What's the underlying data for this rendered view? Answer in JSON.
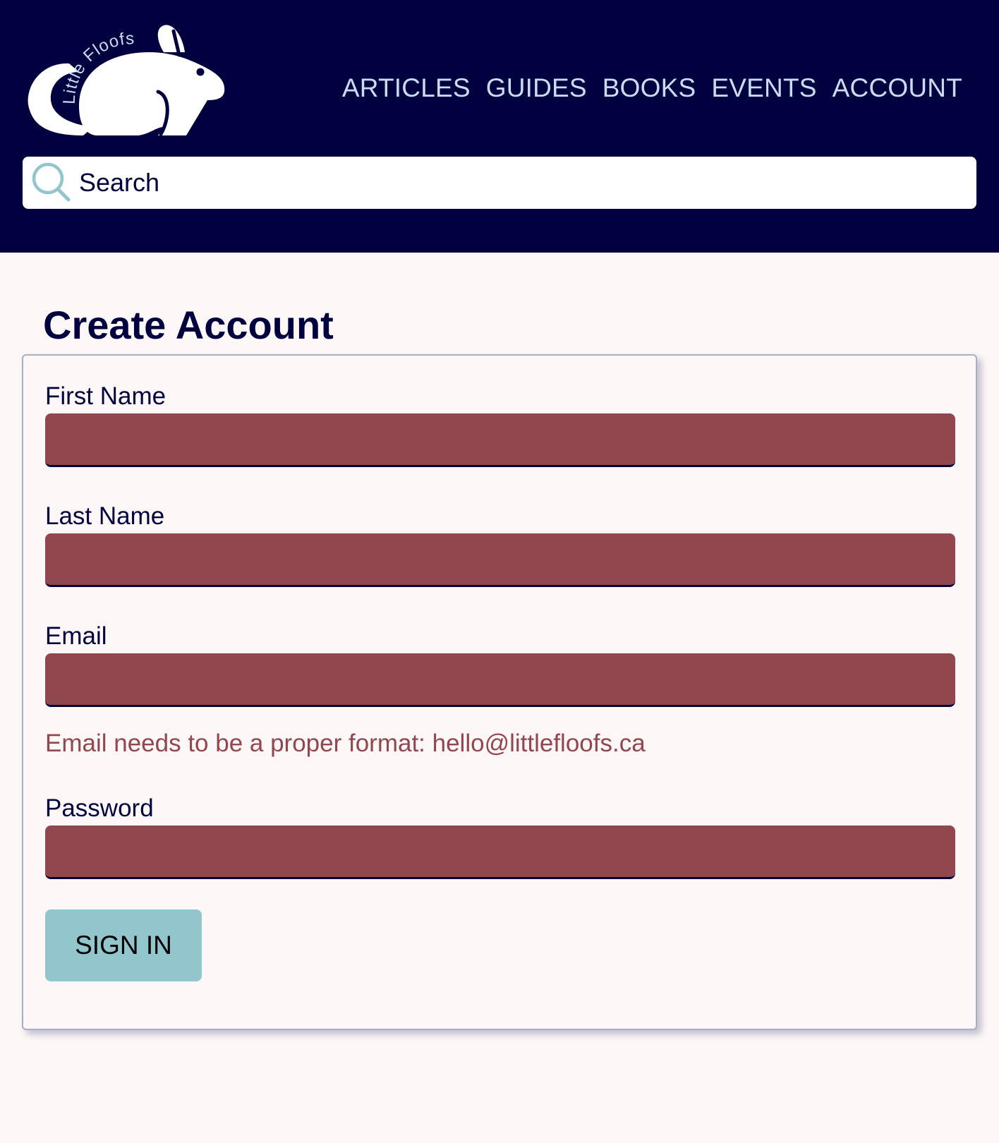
{
  "header": {
    "logo": {
      "text": "Little Floofs"
    },
    "nav": [
      {
        "label": "ARTICLES"
      },
      {
        "label": "GUIDES"
      },
      {
        "label": "BOOKS"
      },
      {
        "label": "EVENTS"
      },
      {
        "label": "ACCOUNT"
      }
    ],
    "search": {
      "placeholder": "Search",
      "value": ""
    }
  },
  "page": {
    "title": "Create Account"
  },
  "form": {
    "first_name": {
      "label": "First Name",
      "value": ""
    },
    "last_name": {
      "label": "Last Name",
      "value": ""
    },
    "email": {
      "label": "Email",
      "value": "",
      "error": "Email needs to be a proper format: hello@littlefloofs.ca"
    },
    "password": {
      "label": "Password",
      "value": ""
    },
    "submit_label": "SIGN IN"
  },
  "colors": {
    "header_bg": "#010140",
    "nav_text": "#c9dcf2",
    "page_bg": "#fdf7f7",
    "input_error_bg": "#92474e",
    "error_text": "#92474e",
    "button_bg": "#92c5cc",
    "search_icon": "#92c5cc"
  },
  "icons": {
    "search": "search-icon",
    "logo": "bunny-logo-icon"
  }
}
